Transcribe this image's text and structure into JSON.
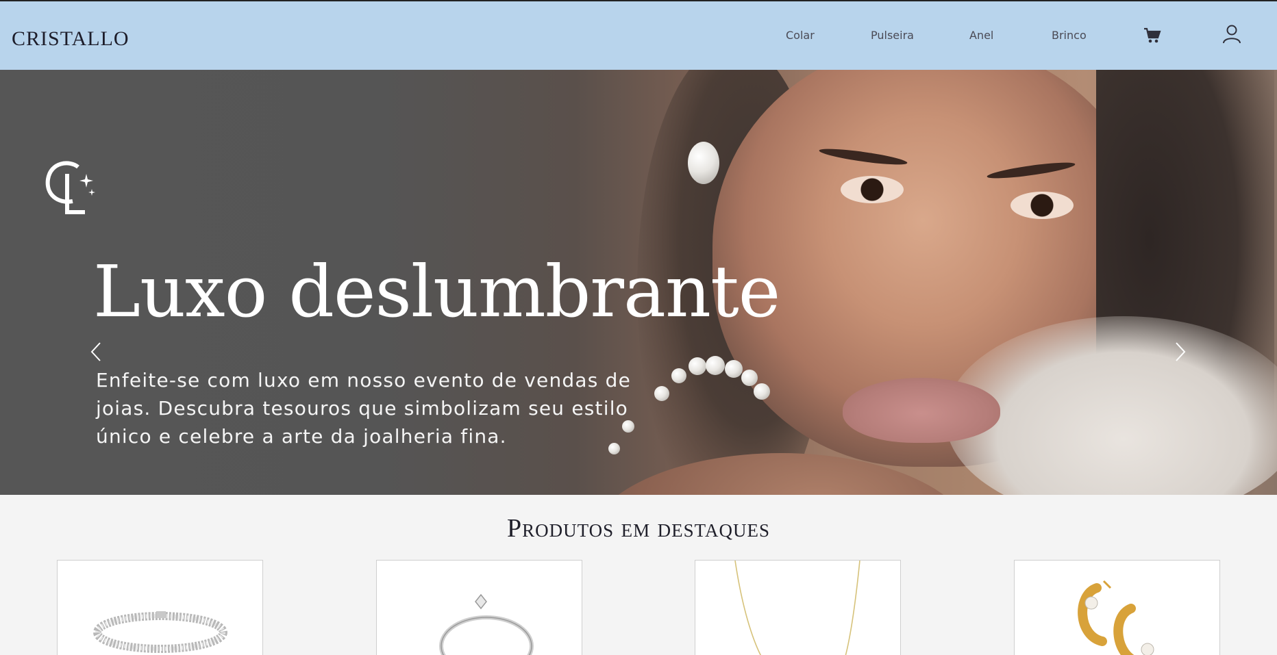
{
  "header": {
    "brand": "CRISTALLO",
    "nav": [
      "Colar",
      "Pulseira",
      "Anel",
      "Brinco"
    ],
    "cart_icon": "cart-icon",
    "user_icon": "user-icon"
  },
  "hero": {
    "logo_icon": "cl-monogram-logo",
    "title": "Luxo deslumbrante",
    "text": "Enfeite-se com luxo em nosso evento de vendas de joias. Descubra tesouros que simbolizam seu estilo único e celebre a arte da joalheria fina.",
    "prev_icon": "chevron-left-icon",
    "next_icon": "chevron-right-icon",
    "slides": 3,
    "active_slide": 1
  },
  "products": {
    "title": "Produtos em destaques",
    "items": [
      {
        "icon": "bracelet-image"
      },
      {
        "icon": "ring-image"
      },
      {
        "icon": "necklace-image"
      },
      {
        "icon": "earrings-image"
      }
    ]
  },
  "colors": {
    "header_bg": "#b8d4ec",
    "page_bg": "#f4f4f4"
  }
}
